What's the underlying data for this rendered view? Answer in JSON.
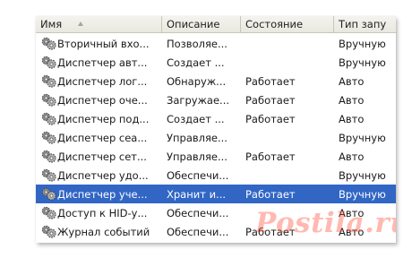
{
  "columns": [
    "Имя",
    "Описание",
    "Состояние",
    "Тип запу"
  ],
  "rows": [
    {
      "name": "Вторичный вхо...",
      "description": "Позволяе...",
      "status": "",
      "startup": "Вручную"
    },
    {
      "name": "Диспетчер авт...",
      "description": "Создает ...",
      "status": "",
      "startup": "Вручную"
    },
    {
      "name": "Диспетчер лог...",
      "description": "Обнаруж...",
      "status": "Работает",
      "startup": "Авто"
    },
    {
      "name": "Диспетчер оче...",
      "description": "Загружае...",
      "status": "Работает",
      "startup": "Авто"
    },
    {
      "name": "Диспетчер под...",
      "description": "Создает ...",
      "status": "Работает",
      "startup": "Авто"
    },
    {
      "name": "Диспетчер сеа...",
      "description": "Управляе...",
      "status": "",
      "startup": "Вручную"
    },
    {
      "name": "Диспетчер сет...",
      "description": "Управляе...",
      "status": "Работает",
      "startup": "Авто"
    },
    {
      "name": "Диспетчер удо...",
      "description": "Обеспечи...",
      "status": "",
      "startup": "Вручную"
    },
    {
      "name": "Диспетчер уче...",
      "description": "Хранит и...",
      "status": "Работает",
      "startup": "Вручную"
    },
    {
      "name": "Доступ к HID-у...",
      "description": "Обеспечи...",
      "status": "",
      "startup": "Авто"
    },
    {
      "name": "Журнал событий",
      "description": "Обеспечи...",
      "status": "Работает",
      "startup": "Авто"
    }
  ],
  "selected_row": 8,
  "row_icon": "service-gear-icon",
  "watermark": "Postila.ru",
  "colors": {
    "selection": "#3166c5",
    "header": "#ebeae3",
    "watermark": "#ff4632"
  }
}
